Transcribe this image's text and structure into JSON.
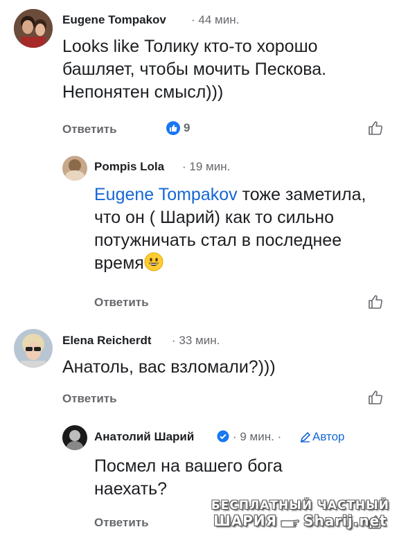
{
  "colors": {
    "link": "#1566d6",
    "meta": "#65676b",
    "text": "#1c1e21",
    "reaction": "#1877f2",
    "verified": "#1877f2"
  },
  "comments": [
    {
      "author": "Eugene Tompakov",
      "time": "· 44 мин.",
      "text": "Looks like Толику кто-то хорошо башляет, чтобы мочить Пескова. Непонятен смысл)))",
      "reply_label": "Ответить",
      "reaction_count": "9",
      "reaction_icon": "thumbs-up-icon",
      "like_icon": "like-icon"
    },
    {
      "author": "Pompis Lola",
      "time": "· 19 мин.",
      "mention": "Eugene Tompakov",
      "text": " тоже заметила, что он ( Шарий) как то сильно  потужничать  стал в последнее время",
      "emoji": "grinning-face",
      "reply_label": "Ответить",
      "like_icon": "like-icon"
    },
    {
      "author": "Elena Reicherdt",
      "time": "· 33 мин.",
      "text": "Анатоль, вас взломали?)))",
      "reply_label": "Ответить",
      "like_icon": "like-icon"
    },
    {
      "author": "Анатолий Шарий",
      "verified_icon": "verified-badge-icon",
      "time": "· 9 мин. ·",
      "author_tag": "Автор",
      "author_tag_icon": "pencil-icon",
      "text": "Посмел на вашего бога наехать?",
      "reply_label": "Ответить",
      "like_icon": "like-icon"
    }
  ],
  "watermark": {
    "line1": "БЕСПЛАТНЫЙ ЧАСТНЫЙ",
    "line2a": "ШАРИЯ",
    "line2b": "Sharij.net",
    "icon": "pointing-hand-icon"
  }
}
